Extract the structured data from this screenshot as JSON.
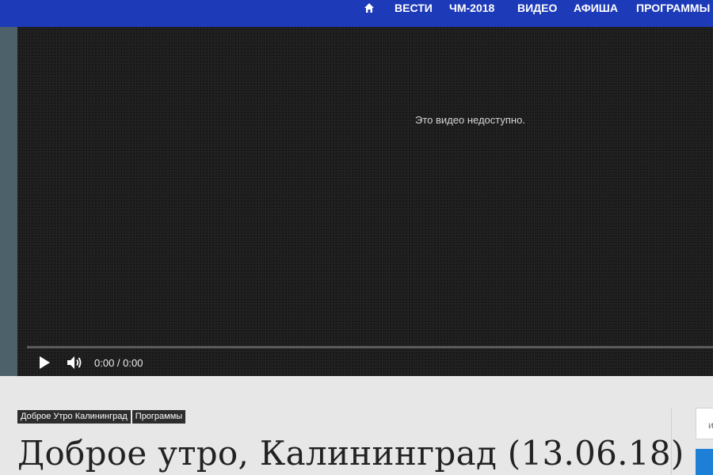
{
  "nav": {
    "home_icon": "home-icon",
    "items": [
      "ВЕСТИ",
      "ЧМ-2018",
      "ВИДЕО",
      "АФИША",
      "ПРОГРАММЫ"
    ],
    "bg_color": "#1d3ab8"
  },
  "video": {
    "message": "Это видео недоступно.",
    "time": "0:00 / 0:00",
    "play_icon": "play-icon",
    "volume_icon": "volume-icon"
  },
  "article": {
    "tags": [
      "Доброе Утро Калининград",
      "Программы"
    ],
    "title": "Доброе утро, Калининград (13.06.18)"
  },
  "sidebar": {
    "search_placeholder": "и",
    "accent_color": "#1d7fd6"
  }
}
